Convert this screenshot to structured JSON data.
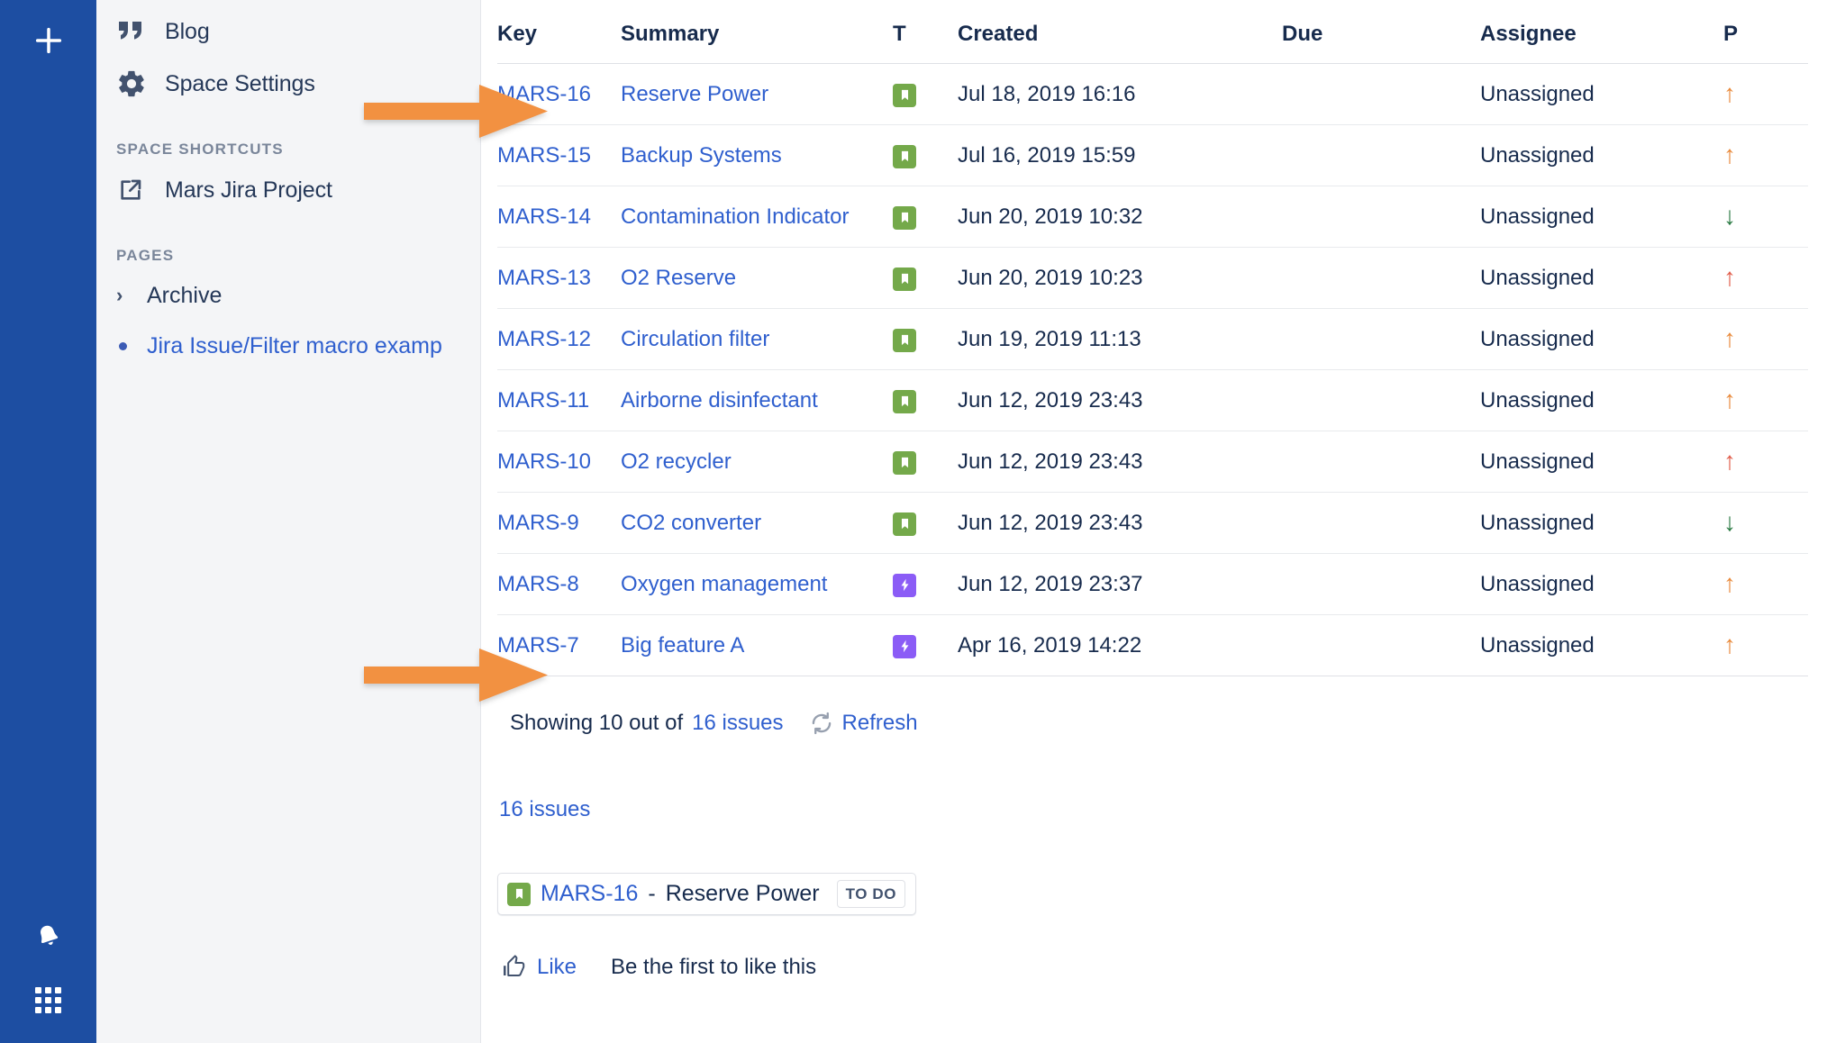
{
  "rail": {
    "create_icon": "plus-icon",
    "notifications_icon": "bell-icon",
    "app_switcher_icon": "app-switcher-grid-icon"
  },
  "sidebar": {
    "nav_items": [
      {
        "label": "Blog",
        "icon": "quote-icon"
      },
      {
        "label": "Space Settings",
        "icon": "gear-icon"
      }
    ],
    "shortcuts_heading": "SPACE SHORTCUTS",
    "shortcuts": [
      {
        "label": "Mars Jira Project",
        "icon": "external-link-icon"
      }
    ],
    "pages_heading": "PAGES",
    "pages": [
      {
        "label": "Archive",
        "type": "collapsed",
        "icon": "chevron-right-icon"
      },
      {
        "label": "Jira Issue/Filter macro examp",
        "type": "page",
        "icon": "bullet-dot-icon"
      }
    ]
  },
  "table": {
    "columns": [
      "Key",
      "Summary",
      "T",
      "Created",
      "Due",
      "Assignee",
      "P"
    ],
    "rows": [
      {
        "key": "MARS-16",
        "summary": "Reserve Power",
        "type": "story",
        "created": "Jul 18, 2019 16:16",
        "due": "",
        "assignee": "Unassigned",
        "priority": "medium",
        "priority_glyph": "↑"
      },
      {
        "key": "MARS-15",
        "summary": "Backup Systems",
        "type": "story",
        "created": "Jul 16, 2019 15:59",
        "due": "",
        "assignee": "Unassigned",
        "priority": "medium",
        "priority_glyph": "↑"
      },
      {
        "key": "MARS-14",
        "summary": "Contamination Indicator",
        "type": "story",
        "created": "Jun 20, 2019 10:32",
        "due": "",
        "assignee": "Unassigned",
        "priority": "low",
        "priority_glyph": "↓"
      },
      {
        "key": "MARS-13",
        "summary": "O2 Reserve",
        "type": "story",
        "created": "Jun 20, 2019 10:23",
        "due": "",
        "assignee": "Unassigned",
        "priority": "high",
        "priority_glyph": "↑"
      },
      {
        "key": "MARS-12",
        "summary": "Circulation filter",
        "type": "story",
        "created": "Jun 19, 2019 11:13",
        "due": "",
        "assignee": "Unassigned",
        "priority": "medium",
        "priority_glyph": "↑"
      },
      {
        "key": "MARS-11",
        "summary": "Airborne disinfectant",
        "type": "story",
        "created": "Jun 12, 2019 23:43",
        "due": "",
        "assignee": "Unassigned",
        "priority": "medium",
        "priority_glyph": "↑"
      },
      {
        "key": "MARS-10",
        "summary": "O2 recycler",
        "type": "story",
        "created": "Jun 12, 2019 23:43",
        "due": "",
        "assignee": "Unassigned",
        "priority": "high",
        "priority_glyph": "↑"
      },
      {
        "key": "MARS-9",
        "summary": "CO2 converter",
        "type": "story",
        "created": "Jun 12, 2019 23:43",
        "due": "",
        "assignee": "Unassigned",
        "priority": "low",
        "priority_glyph": "↓"
      },
      {
        "key": "MARS-8",
        "summary": "Oxygen management",
        "type": "epic",
        "created": "Jun 12, 2019 23:37",
        "due": "",
        "assignee": "Unassigned",
        "priority": "medium",
        "priority_glyph": "↑"
      },
      {
        "key": "MARS-7",
        "summary": "Big feature A",
        "type": "epic",
        "created": "Apr 16, 2019 14:22",
        "due": "",
        "assignee": "Unassigned",
        "priority": "medium",
        "priority_glyph": "↑"
      }
    ]
  },
  "footer": {
    "showing_prefix": "Showing 10 out of",
    "showing_link": "16 issues",
    "refresh_label": "Refresh",
    "refresh_icon": "refresh-icon"
  },
  "issues_count_link": "16 issues",
  "issue_chip": {
    "type_icon": "story-bookmark-icon",
    "key": "MARS-16",
    "separator": "-",
    "summary": "Reserve Power",
    "status": "TO DO"
  },
  "like": {
    "icon": "thumbs-up-icon",
    "label": "Like",
    "hint": "Be the first to like this"
  },
  "colors": {
    "rail_blue": "#1d4ea2",
    "sidebar_gray": "#f4f5f7",
    "link_blue": "#2f5fce",
    "story_green": "#74a94a",
    "epic_purple": "#8b5cf6",
    "priority_medium": "#e8893a",
    "priority_high": "#e05b49",
    "priority_low": "#2a7a43",
    "annotation_orange": "#f29141"
  },
  "annotations": [
    {
      "name": "arrow-to-first-row",
      "target": "MARS-16 table row"
    },
    {
      "name": "arrow-to-issue-chip",
      "target": "MARS-16 inline issue chip"
    }
  ]
}
